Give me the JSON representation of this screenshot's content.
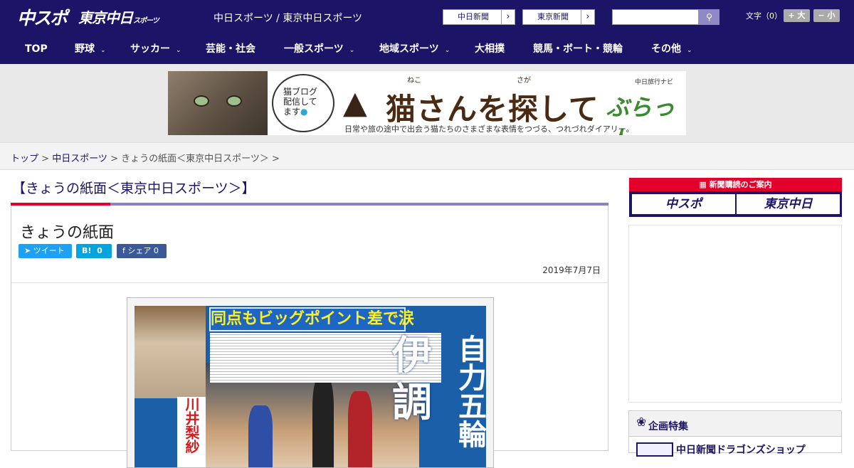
{
  "header": {
    "logo_chuspo": "中スポ",
    "logo_tokyo": "東京中日",
    "logo_tokyo_sub": "スポーツ",
    "site_name": "中日スポーツ / 東京中日スポーツ",
    "papers": [
      {
        "label": "中日新聞"
      },
      {
        "label": "東京新聞"
      }
    ],
    "paper_arrow": "›",
    "search_icon": "🔍",
    "fontsize_label": "文字（0）",
    "fontsize_plus": "+ 大",
    "fontsize_minus": "− 小"
  },
  "nav": {
    "items": [
      {
        "label": "TOP",
        "dropdown": false
      },
      {
        "label": "野球",
        "dropdown": true
      },
      {
        "label": "サッカー",
        "dropdown": true
      },
      {
        "label": "芸能・社会",
        "dropdown": false
      },
      {
        "label": "一般スポーツ",
        "dropdown": true
      },
      {
        "label": "地域スポーツ",
        "dropdown": true
      },
      {
        "label": "大相撲",
        "dropdown": false
      },
      {
        "label": "競馬・ボート・競輪",
        "dropdown": false
      },
      {
        "label": "その他",
        "dropdown": true
      }
    ],
    "chevron": "⌄"
  },
  "banner": {
    "bubble_l1": "猫ブログ",
    "bubble_l2": "配信して",
    "bubble_l3": "ます",
    "ruby1": "ねこ",
    "ruby2": "さが",
    "title": "猫さんを探して",
    "navi_small": "中日旅行ナビ",
    "brand": "ぶらっ人",
    "subtitle": "日常や旅の途中で出会う猫たちのさまざまな表情をつづる、つれづれダイアリー。"
  },
  "breadcrumb": {
    "home": "トップ",
    "sep": " > ",
    "section": "中日スポーツ",
    "current": "きょうの紙面＜東京中日スポーツ＞"
  },
  "page": {
    "heading": "【きょうの紙面＜東京中日スポーツ＞】",
    "article_title": "きょうの紙面",
    "share": {
      "tweet": "ツイート",
      "hatena": "B!",
      "hatena_count": "0",
      "facebook": "シェア",
      "facebook_count": "0"
    },
    "date": "2019年7月7日",
    "paper_headline": "同点もビッグポイント差で涙",
    "paper_vertical": "自力五輪",
    "paper_big": "伊調",
    "paper_red": "川井梨紗"
  },
  "sidebar": {
    "subscribe_title": "新聞購読のご案内",
    "btn1": "中スポ",
    "btn2": "東京中日",
    "kikaku_title": "企画特集",
    "kikaku_item": "中日新聞ドラゴンズショップ"
  }
}
